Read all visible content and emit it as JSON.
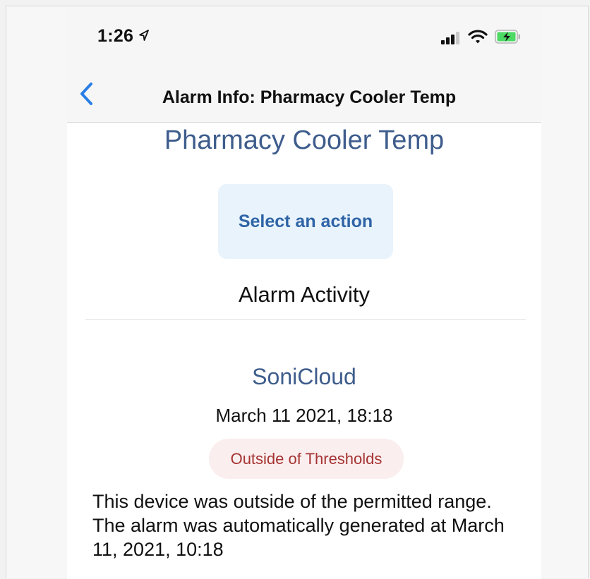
{
  "status_bar": {
    "time": "1:26",
    "icons": [
      "location-arrow-icon",
      "signal-icon",
      "wifi-icon",
      "battery-charging-icon"
    ],
    "battery_color": "#4cd964"
  },
  "nav": {
    "back_icon": "chevron-left-icon",
    "title": "Alarm Info: Pharmacy Cooler Temp"
  },
  "alarm": {
    "name": "Pharmacy Cooler Temp",
    "action_button": "Select an action",
    "section_heading": "Alarm Activity"
  },
  "activity": {
    "source": "SoniCloud",
    "timestamp": "March 11 2021, 18:18",
    "status": "Outside of Thresholds",
    "description": "This device was outside of the permitted range. The alarm was automatically generated at March 11, 2021, 10:18"
  },
  "colors": {
    "accent": "#2f64a6",
    "title_blue": "#3e5d8c",
    "ios_blue": "#2a7ee5",
    "status_red": "#a53333",
    "status_bg": "#fbeeee",
    "action_bg": "#e8f3fc"
  }
}
